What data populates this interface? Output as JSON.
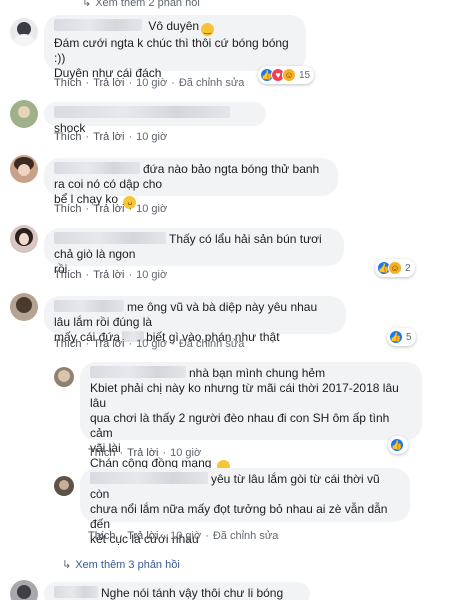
{
  "top_more": "Xem thêm 2 phản hồi",
  "actions": {
    "like": "Thích",
    "reply": "Trả lời",
    "edit": "Đã chỉnh sửa",
    "sep": "·"
  },
  "comments": [
    {
      "line1_suffix": " Vô duyên",
      "line2": "Đám cưới ngta k chúc thì thôi cứ bóng bóng :))",
      "line3": "Duyên như cái đách",
      "time": "10 giờ",
      "reaction_count": "15"
    },
    {
      "text": "shock",
      "time": "10 giờ"
    },
    {
      "line1": "đứa nào bảo ngta bóng thử banh ra coi nó có dập cho",
      "line2": "bể l chạy ko",
      "time": "10 giờ"
    },
    {
      "line1": "Thấy có lẩu hải sản bún tươi chả giò là ngon",
      "line2": "rồi",
      "time": "10 giờ",
      "reaction_count": "2"
    },
    {
      "line1": "me ông vũ và bà diệp này yêu nhau lâu lắm rồi đúng là",
      "line2a": "mấy cái đứa",
      "line2b": "biết gì vào phán như thật",
      "time": "10 giờ",
      "reaction_count": "5"
    },
    {
      "line1": "nhà bạn mình chung hẻm",
      "line2": "Kbiet phải chị này ko nhưng từ mãi cái thời 2017-2018 lâu lâu",
      "line3": "qua chơi là thấy 2 người đèo nhau đi con SH ôm ấp tình cảm",
      "line4": "vãi lài",
      "line5": "Chán cộng đồng mạng",
      "time": "10 giờ"
    },
    {
      "line1": "yêu từ lâu lắm gòi từ cái thời vũ còn",
      "line2": "chưa nổi lắm nữa mấy đọt tưởng bỏ nhau ai zè vẫn dẫn đến",
      "line3": "kết cục là cưới nhau",
      "time": "10 giờ"
    },
    {
      "text": "Nghe nói tánh vậy thôi chư li bóng nha"
    }
  ],
  "bottom_more": "Xem thêm 3 phản hồi",
  "colors": {
    "bubble": "#f2f3f5",
    "link": "#385898",
    "like": "#1877f2",
    "love": "#f33e58",
    "haha": "#f7b125"
  }
}
